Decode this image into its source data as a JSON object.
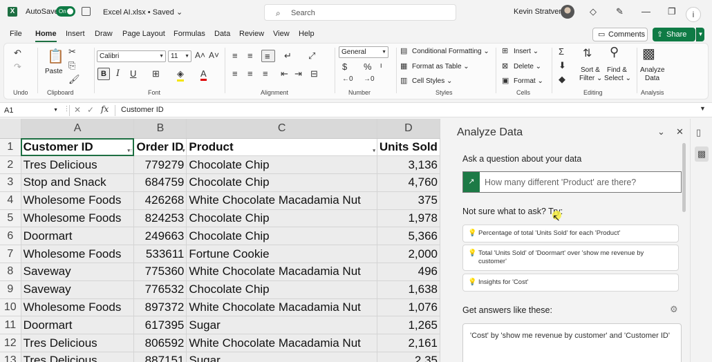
{
  "titlebar": {
    "autosave_label": "AutoSave",
    "autosave_state": "On",
    "file_title": "Excel AI.xlsx • Saved ⌄",
    "search_placeholder": "Search",
    "user_name": "Kevin Stratvert"
  },
  "menu": {
    "tabs": [
      "File",
      "Home",
      "Insert",
      "Draw",
      "Page Layout",
      "Formulas",
      "Data",
      "Review",
      "View",
      "Help"
    ],
    "active": "Home",
    "comments_label": "Comments",
    "share_label": "Share"
  },
  "ribbon": {
    "undo_label": "Undo",
    "clipboard_label": "Clipboard",
    "paste_label": "Paste",
    "font_label": "Font",
    "font_name": "Calibri",
    "font_size": "11",
    "alignment_label": "Alignment",
    "number_label": "Number",
    "number_format": "General",
    "styles_label": "Styles",
    "conditional_formatting": "Conditional Formatting ⌄",
    "format_as_table": "Format as Table ⌄",
    "cell_styles": "Cell Styles ⌄",
    "cells_label": "Cells",
    "insert_label": "Insert ⌄",
    "delete_label": "Delete ⌄",
    "format_label": "Format ⌄",
    "editing_label": "Editing",
    "sort_filter": "Sort &",
    "sort_filter2": "Filter ⌄",
    "find_select": "Find &",
    "find_select2": "Select ⌄",
    "analysis_label": "Analysis",
    "analyze_data": "Analyze",
    "analyze_data2": "Data"
  },
  "formula_bar": {
    "name_box": "A1",
    "formula": "Customer ID"
  },
  "sheet": {
    "columns": [
      "A",
      "B",
      "C",
      "D"
    ],
    "headers": [
      "Customer ID",
      "Order ID",
      "Product",
      "Units Sold"
    ],
    "rows": [
      {
        "n": "2",
        "a": "Tres Delicious",
        "b": "779279",
        "c": "Chocolate Chip",
        "d": "3,136"
      },
      {
        "n": "3",
        "a": "Stop and Snack",
        "b": "684759",
        "c": "Chocolate Chip",
        "d": "4,760"
      },
      {
        "n": "4",
        "a": "Wholesome Foods",
        "b": "426268",
        "c": "White Chocolate Macadamia Nut",
        "d": "375"
      },
      {
        "n": "5",
        "a": "Wholesome Foods",
        "b": "824253",
        "c": "Chocolate Chip",
        "d": "1,978"
      },
      {
        "n": "6",
        "a": "Doormart",
        "b": "249663",
        "c": "Chocolate Chip",
        "d": "5,366"
      },
      {
        "n": "7",
        "a": "Wholesome Foods",
        "b": "533611",
        "c": "Fortune Cookie",
        "d": "2,000"
      },
      {
        "n": "8",
        "a": "Saveway",
        "b": "775360",
        "c": "White Chocolate Macadamia Nut",
        "d": "496"
      },
      {
        "n": "9",
        "a": "Saveway",
        "b": "776532",
        "c": "Chocolate Chip",
        "d": "1,638"
      },
      {
        "n": "10",
        "a": "Wholesome Foods",
        "b": "897372",
        "c": "White Chocolate Macadamia Nut",
        "d": "1,076"
      },
      {
        "n": "11",
        "a": "Doormart",
        "b": "617395",
        "c": "Sugar",
        "d": "1,265"
      },
      {
        "n": "12",
        "a": "Tres Delicious",
        "b": "806592",
        "c": "White Chocolate Macadamia Nut",
        "d": "2,161"
      },
      {
        "n": "13",
        "a": "Tres Delicious",
        "b": "887151",
        "c": "Sugar",
        "d": "2,35"
      }
    ]
  },
  "analyze_pane": {
    "title": "Analyze Data",
    "ask_label": "Ask a question about your data",
    "ask_placeholder": "How many different 'Product' are there?",
    "try_label": "Not sure what to ask? Try:",
    "suggestions": [
      "Percentage of total 'Units Sold' for each 'Product'",
      "Total 'Units Sold' of 'Doormart' over 'show me revenue by customer'",
      "Insights for 'Cost'"
    ],
    "answers_label": "Get answers like these:",
    "answer_card": "'Cost' by 'show me revenue by customer' and 'Customer ID'"
  },
  "colors": {
    "excel_green": "#1d6f42",
    "share_green": "#0f7b45",
    "ask_icon_green": "#1d7a46"
  }
}
